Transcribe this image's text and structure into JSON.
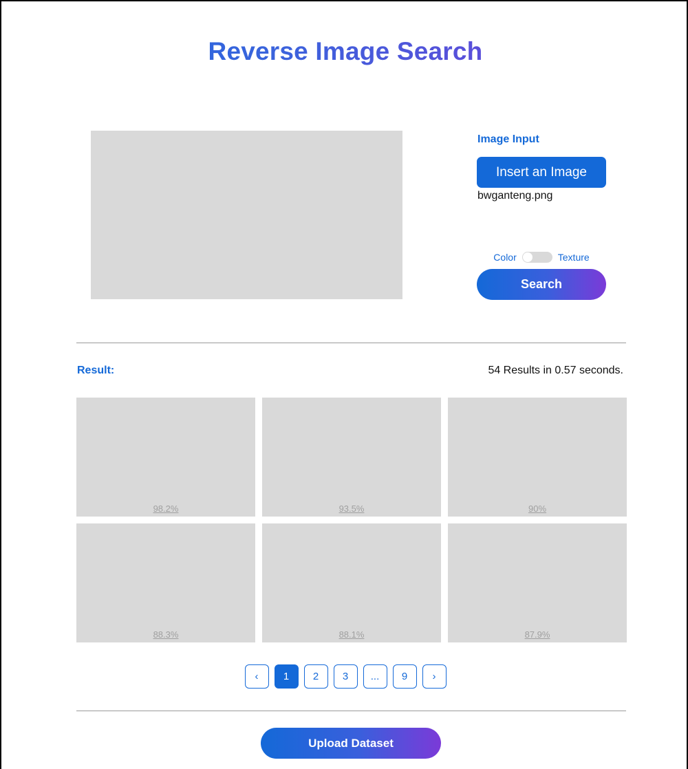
{
  "header": {
    "title": "Reverse Image Search"
  },
  "input": {
    "label": "Image Input",
    "insert_button": "Insert an Image",
    "filename": "bwganteng.png",
    "toggle_left": "Color",
    "toggle_right": "Texture",
    "toggle_state": "Color",
    "search_button": "Search"
  },
  "results": {
    "label": "Result:",
    "stats": "54 Results in 0.57 seconds.",
    "items": [
      {
        "score": "98.2%"
      },
      {
        "score": "93.5%"
      },
      {
        "score": "90%"
      },
      {
        "score": "88.3%"
      },
      {
        "score": "88.1%"
      },
      {
        "score": "87.9%"
      }
    ]
  },
  "pagination": {
    "prev": "‹",
    "pages": [
      "1",
      "2",
      "3",
      "...",
      "9"
    ],
    "current": "1",
    "next": "›"
  },
  "footer": {
    "upload_button": "Upload Dataset"
  },
  "colors": {
    "accent": "#1469d8",
    "gradient_end": "#7b3ad8",
    "placeholder": "#d9d9d9"
  }
}
